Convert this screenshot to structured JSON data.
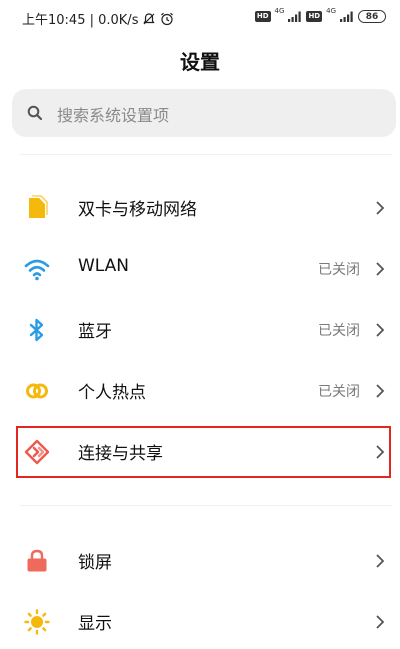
{
  "status_bar": {
    "time_speed": "上午10:45 | 0.0K/s",
    "hd1": "HD",
    "net1": "4G",
    "hd2": "HD",
    "net2": "4G",
    "battery": "86"
  },
  "page": {
    "title": "设置"
  },
  "search": {
    "placeholder": "搜索系统设置项"
  },
  "items": [
    {
      "label": "双卡与移动网络",
      "status": "",
      "icon": "sim-card-icon",
      "color": "#f5b90e"
    },
    {
      "label": "WLAN",
      "status": "已关闭",
      "icon": "wifi-icon",
      "color": "#2b9be5"
    },
    {
      "label": "蓝牙",
      "status": "已关闭",
      "icon": "bluetooth-icon",
      "color": "#2b9be5"
    },
    {
      "label": "个人热点",
      "status": "已关闭",
      "icon": "hotspot-icon",
      "color": "#f5b90e"
    },
    {
      "label": "连接与共享",
      "status": "",
      "icon": "connection-sharing-icon",
      "color": "#ec5a4f"
    },
    {
      "label": "锁屏",
      "status": "",
      "icon": "lock-icon",
      "color": "#ef6a5a"
    },
    {
      "label": "显示",
      "status": "",
      "icon": "sun-icon",
      "color": "#f5b90e"
    }
  ],
  "colors": {
    "highlight": "#e3271f",
    "search_bg": "#efefef"
  }
}
